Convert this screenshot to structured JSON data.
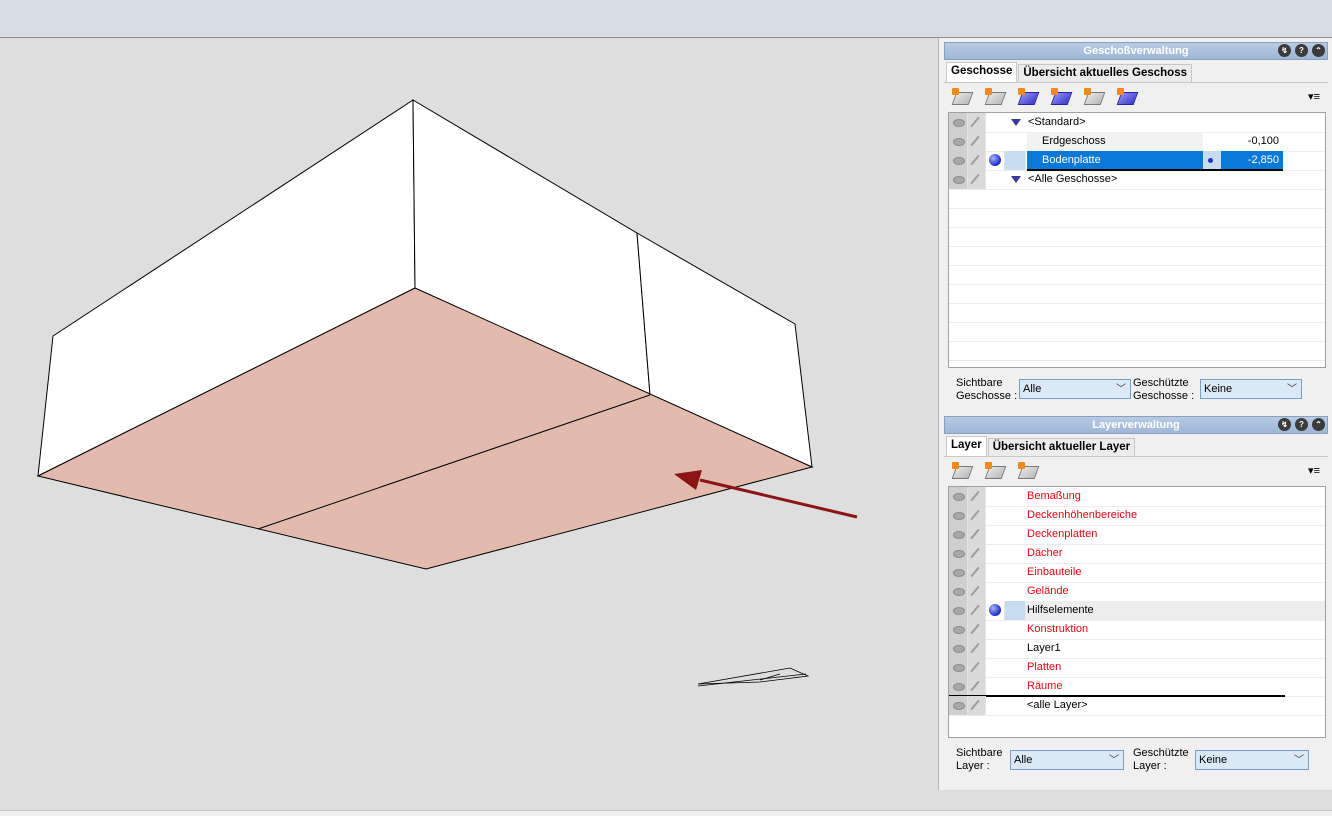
{
  "geschoss_panel": {
    "title": "Geschoßverwaltung",
    "tabs": [
      "Geschosse",
      "Übersicht aktuelles Geschoss"
    ],
    "rows": [
      {
        "name": "<Standard>",
        "value": ""
      },
      {
        "name": "Erdgeschoss",
        "value": "-0,100"
      },
      {
        "name": "Bodenplatte",
        "value": "-2,850"
      },
      {
        "name": "<Alle Geschosse>",
        "value": ""
      }
    ],
    "visible_label": "Sichtbare\nGeschosse :",
    "visible_value": "Alle",
    "protected_label": "Geschützte\nGeschosse :",
    "protected_value": "Keine"
  },
  "layer_panel": {
    "title": "Layerverwaltung",
    "tabs": [
      "Layer",
      "Übersicht aktueller Layer"
    ],
    "rows": [
      {
        "name": "Bemaßung"
      },
      {
        "name": "Deckenhöhenbereiche"
      },
      {
        "name": "Deckenplatten"
      },
      {
        "name": "Dächer"
      },
      {
        "name": "Einbauteile"
      },
      {
        "name": "Gelände"
      },
      {
        "name": "Hilfselemente"
      },
      {
        "name": "Konstruktion"
      },
      {
        "name": "Layer1"
      },
      {
        "name": "Platten"
      },
      {
        "name": "Räume"
      },
      {
        "name": "<alle Layer>"
      }
    ],
    "visible_label": "Sichtbare\nLayer :",
    "visible_value": "Alle",
    "protected_label": "Geschützte\nLayer :",
    "protected_value": "Keine"
  },
  "title_buttons": [
    "↯",
    "?",
    "⌃"
  ],
  "menu_glyph": "▾≡",
  "colors": {
    "floor_fill": "#e2bbae",
    "arrow": "#8b1414",
    "selection": "#0a78d7",
    "inactive_layer_text": "#e30613"
  }
}
